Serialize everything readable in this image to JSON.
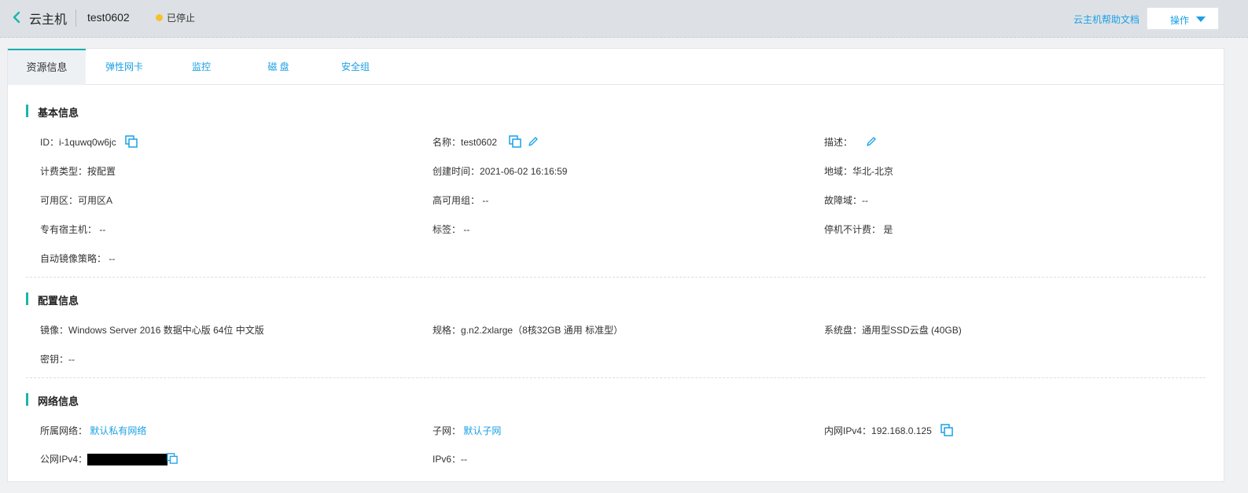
{
  "header": {
    "title": "云主机",
    "instance_name": "test0602",
    "status": "已停止",
    "help_link": "云主机帮助文档",
    "ops_label": "操作"
  },
  "colors": {
    "accent": "#1aa0e6",
    "section_bar": "#19b6a7",
    "status_stopped": "#f5c22e"
  },
  "tabs": [
    {
      "label": "资源信息"
    },
    {
      "label": "弹性网卡"
    },
    {
      "label": "监控"
    },
    {
      "label": "磁 盘"
    },
    {
      "label": "安全组"
    }
  ],
  "basic": {
    "title": "基本信息",
    "id_label": "ID：",
    "id_value": "i-1quwq0w6jc",
    "name_label": "名称：",
    "name_value": "test0602",
    "desc_label": "描述：",
    "billing_label": "计费类型：",
    "billing_value": "按配置",
    "created_label": "创建时间：",
    "created_value": "2021-06-02 16:16:59",
    "region_label": "地域：",
    "region_value": "华北-北京",
    "az_label": "可用区：",
    "az_value": "可用区A",
    "ha_label": "高可用组：",
    "ha_value": "--",
    "fault_label": "故障域：",
    "fault_value": "--",
    "dedicated_label": "专有宿主机：",
    "dedicated_value": "--",
    "tag_label": "标签：",
    "tag_value": "--",
    "stop_bill_label": "停机不计费：",
    "stop_bill_value": "是",
    "snapshot_label": "自动镜像策略：",
    "snapshot_value": "--"
  },
  "config": {
    "title": "配置信息",
    "image_label": "镜像：",
    "image_value": "Windows Server 2016 数据中心版 64位 中文版",
    "spec_label": "规格：",
    "spec_value": "g.n2.2xlarge（8核32GB 通用 标准型）",
    "sysdisk_label": "系统盘：",
    "sysdisk_value": "通用型SSD云盘 (40GB)",
    "key_label": "密钥：",
    "key_value": "--"
  },
  "network": {
    "title": "网络信息",
    "vpc_label": "所属网络：",
    "vpc_value": "默认私有网络",
    "subnet_label": "子网：",
    "subnet_value": "默认子网",
    "private_ip_label": "内网IPv4：",
    "private_ip_value": "192.168.0.125",
    "public_ip_label": "公网IPv4：",
    "ipv6_label": "IPv6：",
    "ipv6_value": "--"
  }
}
